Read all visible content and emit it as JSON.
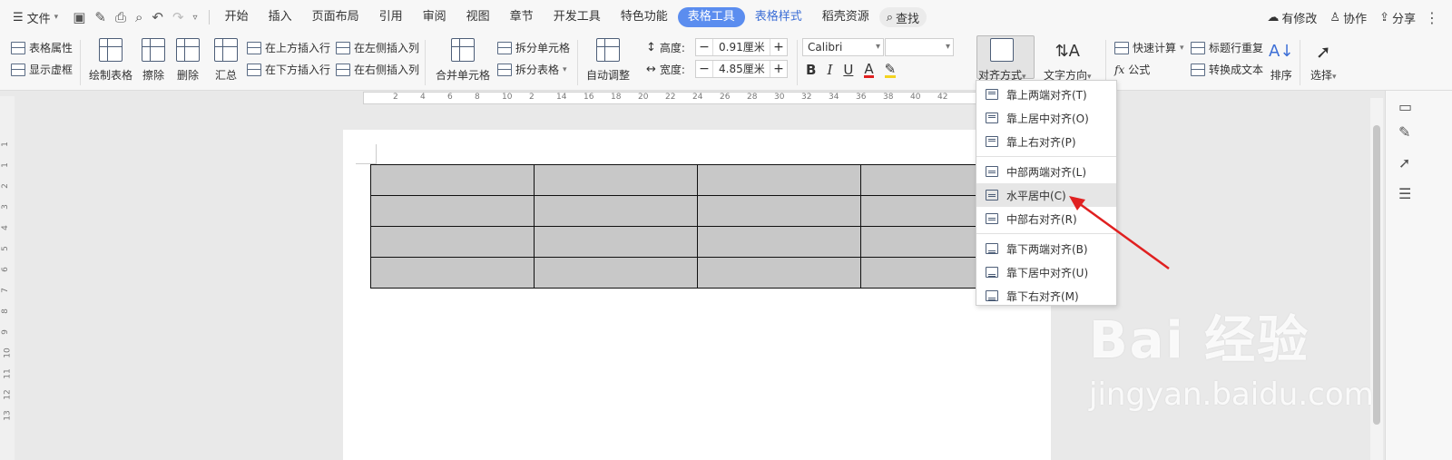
{
  "tabbar": {
    "file_menu": "文件",
    "tabs": [
      "开始",
      "插入",
      "页面布局",
      "引用",
      "审阅",
      "视图",
      "章节",
      "开发工具",
      "特色功能"
    ],
    "table_tools": "表格工具",
    "table_style": "表格样式",
    "docer": "稻壳资源",
    "search": "查找",
    "right": {
      "modified": "有修改",
      "collab": "协作",
      "share": "分享"
    }
  },
  "ribbon": {
    "table_props": "表格属性",
    "show_gridlines": "显示虚框",
    "draw_table": "绘制表格",
    "erase": "擦除",
    "delete": "删除",
    "summary": "汇总",
    "insert_above": "在上方插入行",
    "insert_below": "在下方插入行",
    "insert_left": "在左侧插入列",
    "insert_right": "在右侧插入列",
    "merge": "合并单元格",
    "split_cells": "拆分单元格",
    "split_table": "拆分表格",
    "autofit": "自动调整",
    "height_label": "高度:",
    "height_value": "0.91厘米",
    "width_label": "宽度:",
    "width_value": "4.85厘米",
    "font_name": "Calibri",
    "font_size": "",
    "align": "对齐方式",
    "text_direction": "文字方向",
    "quick_calc": "快速计算",
    "formula": "公式",
    "repeat_header": "标题行重复",
    "to_text": "转换成文本",
    "sort": "排序",
    "select": "选择"
  },
  "ruler": {
    "h_ticks": [
      "2",
      "4",
      "6",
      "8",
      "10",
      "2",
      "14",
      "16",
      "18",
      "20",
      "22",
      "24",
      "26",
      "28",
      "30",
      "32",
      "34",
      "36",
      "38",
      "40",
      "42"
    ],
    "v_ticks": [
      "1",
      "1",
      "2",
      "3",
      "4",
      "5",
      "6",
      "7",
      "8",
      "9",
      "10",
      "11",
      "12",
      "13"
    ]
  },
  "dropdown": {
    "items": [
      {
        "label": "靠上两端对齐(T)",
        "group": 1
      },
      {
        "label": "靠上居中对齐(O)",
        "group": 1
      },
      {
        "label": "靠上右对齐(P)",
        "group": 1
      },
      {
        "label": "中部两端对齐(L)",
        "group": 2
      },
      {
        "label": "水平居中(C)",
        "group": 2,
        "hovered": true
      },
      {
        "label": "中部右对齐(R)",
        "group": 2
      },
      {
        "label": "靠下两端对齐(B)",
        "group": 3
      },
      {
        "label": "靠下居中对齐(U)",
        "group": 3
      },
      {
        "label": "靠下右对齐(M)",
        "group": 3
      }
    ]
  },
  "table": {
    "rows": 4,
    "cols": 4,
    "cell_color": "#c8c8c8"
  },
  "watermark": {
    "logo": "Bai 经验",
    "url": "jingyan.baidu.com"
  },
  "colors": {
    "accent": "#5b8def",
    "arrow": "#e02020",
    "tab_blue": "#3d6fd6"
  }
}
